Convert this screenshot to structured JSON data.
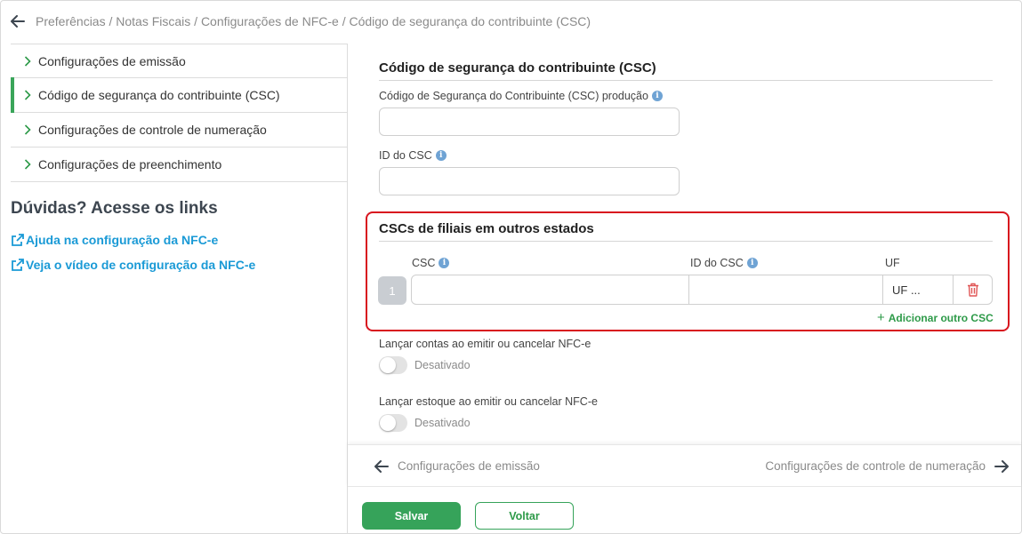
{
  "breadcrumb": {
    "path": "Preferências / Notas Fiscais / Configurações de NFC-e / Código de segurança do contribuinte (CSC)"
  },
  "sidebar": {
    "items": [
      {
        "label": "Configurações de emissão",
        "active": false
      },
      {
        "label": "Código de segurança do contribuinte (CSC)",
        "active": true
      },
      {
        "label": "Configurações de controle de numeração",
        "active": false
      },
      {
        "label": "Configurações de preenchimento",
        "active": false
      }
    ],
    "help_title": "Dúvidas? Acesse os links",
    "links": [
      {
        "label": "Ajuda na configuração da NFC-e"
      },
      {
        "label": "Veja o vídeo de configuração da NFC-e"
      }
    ]
  },
  "csc_section": {
    "title": "Código de segurança do contribuinte (CSC)",
    "csc_production_label": "Código de Segurança do Contribuinte (CSC) produção",
    "csc_production_value": "",
    "csc_id_label": "ID do CSC",
    "csc_id_value": ""
  },
  "branches_section": {
    "title": "CSCs de filiais em outros estados",
    "col_csc": "CSC",
    "col_id": "ID do CSC",
    "col_uf": "UF",
    "rows": [
      {
        "number": "1",
        "csc": "",
        "id": "",
        "uf": "UF ..."
      }
    ],
    "add_label": "Adicionar outro CSC"
  },
  "toggles": [
    {
      "label": "Lançar contas ao emitir ou cancelar NFC-e",
      "state": "Desativado",
      "on": false
    },
    {
      "label": "Lançar estoque ao emitir ou cancelar NFC-e",
      "state": "Desativado",
      "on": false
    }
  ],
  "footer_nav": {
    "prev_label": "Configurações de emissão",
    "next_label": "Configurações de controle de numeração"
  },
  "buttons": {
    "save": "Salvar",
    "back": "Voltar"
  },
  "colors": {
    "accent_green": "#36a35a",
    "link_blue": "#1a9ad6",
    "highlight_red": "#d8141e",
    "trash_red": "#e05555"
  }
}
